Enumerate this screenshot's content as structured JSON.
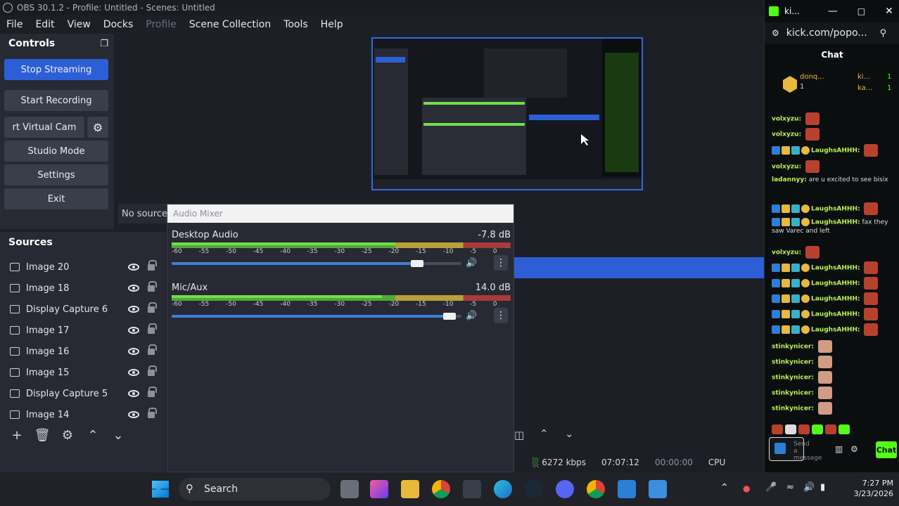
{
  "obs": {
    "title": "OBS 30.1.2 - Profile: Untitled - Scenes: Untitled",
    "menu": [
      "File",
      "Edit",
      "View",
      "Docks",
      "Profile",
      "Scene Collection",
      "Tools",
      "Help"
    ],
    "controls": {
      "header": "Controls",
      "stop_streaming": "Stop Streaming",
      "start_recording": "Start Recording",
      "virtual_cam": "rt Virtual Cam",
      "studio_mode": "Studio Mode",
      "settings": "Settings",
      "exit": "Exit"
    },
    "no_source": "No source",
    "sources": {
      "header": "Sources",
      "items": [
        {
          "name": "Image 20",
          "type": "image"
        },
        {
          "name": "Image 18",
          "type": "image"
        },
        {
          "name": "Display Capture 6",
          "type": "display"
        },
        {
          "name": "Image 17",
          "type": "image"
        },
        {
          "name": "Image 16",
          "type": "image"
        },
        {
          "name": "Image 15",
          "type": "image"
        },
        {
          "name": "Display Capture 5",
          "type": "display"
        },
        {
          "name": "Image 14",
          "type": "image"
        }
      ]
    },
    "mixer": {
      "title": "Audio Mixer",
      "scale": [
        "-60",
        "-55",
        "-50",
        "-45",
        "-40",
        "-35",
        "-30",
        "-25",
        "-20",
        "-15",
        "-10",
        "-5",
        "0"
      ],
      "channels": [
        {
          "name": "Desktop Audio",
          "db": "-7.8 dB",
          "level": 0.66,
          "volume": 0.87
        },
        {
          "name": "Mic/Aux",
          "db": "14.0 dB",
          "level": 0.62,
          "volume": 0.98
        }
      ]
    },
    "status": {
      "bitrate": "6272 kbps",
      "stream_time": "07:07:12",
      "record_time": "00:00:00",
      "cpu": "CPU"
    }
  },
  "kick": {
    "tab_title": "ki...",
    "url": "kick.com/popo...",
    "chat_header": "Chat",
    "top_gifters": [
      "donq...",
      "ki...",
      "ka..."
    ],
    "gifter_counts": [
      "1",
      "1",
      "1"
    ],
    "messages": [
      {
        "user": "volxyzu:",
        "text": ""
      },
      {
        "user": "volxyzu:",
        "text": ""
      },
      {
        "user": "LaughsAHHH:",
        "text": ""
      },
      {
        "user": "volxyzu:",
        "text": ""
      },
      {
        "user": "ladannyy:",
        "text": "are u excited to see bisix"
      },
      {
        "user": "LaughsAHHH:",
        "text": ""
      },
      {
        "user": "LaughsAHHH:",
        "text": "fax they saw Varec and left"
      },
      {
        "user": "volxyzu:",
        "text": ""
      },
      {
        "user": "LaughsAHHH:",
        "text": ""
      },
      {
        "user": "LaughsAHHH:",
        "text": ""
      },
      {
        "user": "LaughsAHHH:",
        "text": ""
      },
      {
        "user": "LaughsAHHH:",
        "text": ""
      },
      {
        "user": "LaughsAHHH:",
        "text": ""
      },
      {
        "user": "stinkynicer:",
        "text": ""
      },
      {
        "user": "stinkynicer:",
        "text": ""
      },
      {
        "user": "stinkynicer:",
        "text": ""
      },
      {
        "user": "stinkynicer:",
        "text": ""
      },
      {
        "user": "stinkynicer:",
        "text": ""
      }
    ],
    "input_placeholder": "Send a message",
    "send_label": "Chat"
  },
  "taskbar": {
    "search": "Search",
    "time": "7:27 PM",
    "date": "3/23/2026"
  },
  "colors": {
    "accent": "#2c5fd6",
    "kick_green": "#53fc18"
  }
}
